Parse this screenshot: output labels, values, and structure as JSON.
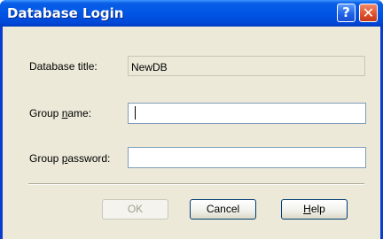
{
  "window": {
    "title": "Database Login"
  },
  "titlebar": {
    "help_glyph": "?",
    "close_glyph": "✕"
  },
  "form": {
    "db_title_label": "Database title:",
    "db_title_value": "NewDB",
    "group_name_label_pre": "Group ",
    "group_name_label_u": "n",
    "group_name_label_post": "ame:",
    "group_name_value": "",
    "group_password_label_pre": "Group ",
    "group_password_label_u": "p",
    "group_password_label_post": "assword:",
    "group_password_value": ""
  },
  "buttons": {
    "ok": "OK",
    "cancel": "Cancel",
    "help_u": "H",
    "help_rest": "elp"
  },
  "state": {
    "ok_enabled": false,
    "focused_field": "group_name"
  },
  "colors": {
    "titlebar": "#0055e5",
    "client": "#ece9d8",
    "close": "#e0502a"
  },
  "icons": {
    "help": "question-mark-icon",
    "close": "close-icon"
  }
}
